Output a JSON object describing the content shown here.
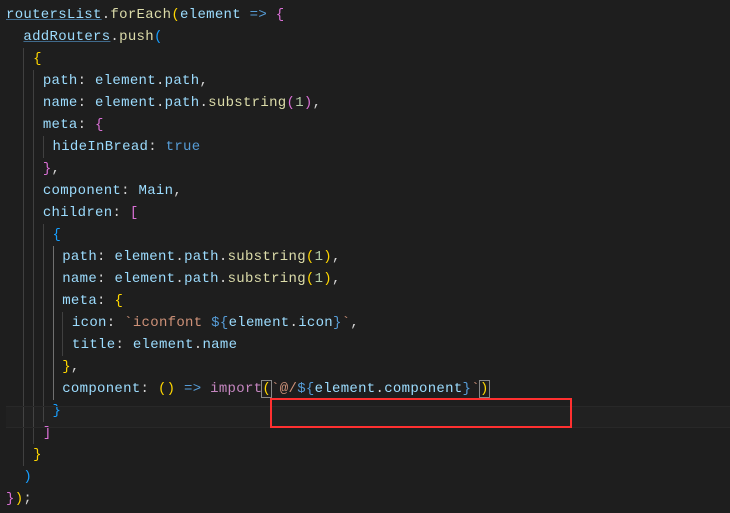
{
  "code": {
    "l1_a": "routersList",
    "l1_b": "forEach",
    "l1_c": "element",
    "l2_a": "addRouters",
    "l2_b": "push",
    "l4_a": "path",
    "l4_b": "element",
    "l4_c": "path",
    "l5_a": "name",
    "l5_b": "element",
    "l5_c": "path",
    "l5_d": "substring",
    "l5_e": "1",
    "l6_a": "meta",
    "l7_a": "hideInBread",
    "l7_b": "true",
    "l9_a": "component",
    "l9_b": "Main",
    "l10_a": "children",
    "l12_a": "path",
    "l12_b": "element",
    "l12_c": "path",
    "l12_d": "substring",
    "l12_e": "1",
    "l13_a": "name",
    "l13_b": "element",
    "l13_c": "path",
    "l13_d": "substring",
    "l13_e": "1",
    "l14_a": "meta",
    "l15_a": "icon",
    "l15_b": "iconfont ",
    "l15_c": "element",
    "l15_d": "icon",
    "l16_a": "title",
    "l16_b": "element",
    "l16_c": "name",
    "l18_a": "component",
    "l18_imp": "import",
    "l18_b": "@/",
    "l18_c": "element",
    "l18_d": "component"
  }
}
